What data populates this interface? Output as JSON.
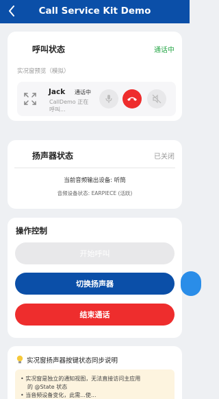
{
  "header": {
    "title": "Call Service Kit Demo",
    "back_icon": "chevron-left-icon"
  },
  "call_card": {
    "title": "呼叫状态",
    "status": "通话中",
    "status_color": "#2aa84a",
    "preview_label": "实况窗预览（模拟）",
    "caller_name": "Jack",
    "caller_status": "通话中",
    "caller_description": "CallDemo 正在呼叫...",
    "buttons": [
      "mic-icon",
      "hangup-icon",
      "speaker-mute-icon"
    ]
  },
  "speaker_card": {
    "title": "扬声器状态",
    "state": "已关闭",
    "output_device": "当前音频输出设备: 听筒",
    "earpiece_state": "音频设备状态: EARPIECE (活跃)"
  },
  "ops_card": {
    "title": "操作控制",
    "start_call": "开始呼叫",
    "toggle_speaker": "切换扬声器",
    "end_call": "结束通话"
  },
  "info_card": {
    "icon": "lightbulb-icon",
    "title": "实况窗扬声器按键状态同步说明",
    "note_line1": "• 实况窗是独立的通知视图，无法直接访问主应用",
    "note_line2": "的 @State 状态",
    "note_line3": "• 当音频设备变化，此需...使..."
  },
  "colors": {
    "brand": "#0b4fa8",
    "danger": "#ee2d2d",
    "success": "#2aa84a",
    "fab": "#2a8de8"
  }
}
